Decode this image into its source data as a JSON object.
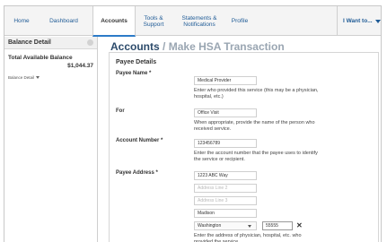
{
  "nav": {
    "home": "Home",
    "dashboard": "Dashboard",
    "accounts": "Accounts",
    "tools": "Tools & Support",
    "statements": "Statements & Notifications",
    "profile": "Profile",
    "i_want_to": "I Want to..."
  },
  "sidebar": {
    "title": "Balance Detail",
    "total_label": "Total Available Balance",
    "total_amount": "$1,044.37",
    "detail_link": "Balance Detail"
  },
  "page": {
    "title": "Accounts",
    "separator": "/",
    "subtitle": "Make HSA Transaction"
  },
  "form": {
    "section_title": "Payee Details",
    "payee_name": {
      "label": "Payee Name *",
      "value": "Medical Provider",
      "help": "Enter who provided this service (this may be a physician, hospital, etc.)"
    },
    "for": {
      "label": "For",
      "value": "Office Visit",
      "help": "When appropriate, provide the name of the person who received service."
    },
    "account_number": {
      "label": "Account Number *",
      "value": "123456789",
      "help": "Enter the account number that the payee uses to identify the service or recipient."
    },
    "payee_address": {
      "label": "Payee Address *",
      "line1": "1223 ABC Way",
      "line2_placeholder": "Address Line 2",
      "line3_placeholder": "Address Line 3",
      "city": "Madison",
      "state": "Washington",
      "zip": "55555",
      "clear_glyph": "✕",
      "help": "Enter the address of physician, hospital, etc. who provided the service."
    }
  }
}
